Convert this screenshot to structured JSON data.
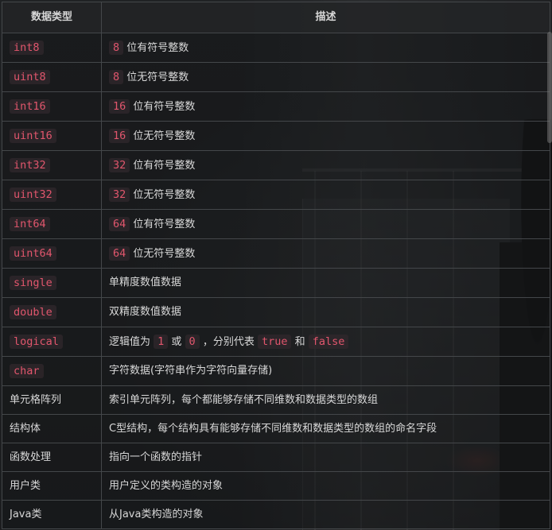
{
  "table": {
    "headers": [
      "数据类型",
      "描述"
    ],
    "rows": [
      {
        "type": "int8",
        "type_code": true,
        "desc": [
          {
            "code": "8"
          },
          {
            "text": " 位有符号整数"
          }
        ]
      },
      {
        "type": "uint8",
        "type_code": true,
        "desc": [
          {
            "code": "8"
          },
          {
            "text": " 位无符号整数"
          }
        ]
      },
      {
        "type": "int16",
        "type_code": true,
        "desc": [
          {
            "code": "16"
          },
          {
            "text": " 位有符号整数"
          }
        ]
      },
      {
        "type": "uint16",
        "type_code": true,
        "desc": [
          {
            "code": "16"
          },
          {
            "text": " 位无符号整数"
          }
        ]
      },
      {
        "type": "int32",
        "type_code": true,
        "desc": [
          {
            "code": "32"
          },
          {
            "text": " 位有符号整数"
          }
        ]
      },
      {
        "type": "uint32",
        "type_code": true,
        "desc": [
          {
            "code": "32"
          },
          {
            "text": " 位无符号整数"
          }
        ]
      },
      {
        "type": "int64",
        "type_code": true,
        "desc": [
          {
            "code": "64"
          },
          {
            "text": " 位有符号整数"
          }
        ]
      },
      {
        "type": "uint64",
        "type_code": true,
        "desc": [
          {
            "code": "64"
          },
          {
            "text": " 位无符号整数"
          }
        ]
      },
      {
        "type": "single",
        "type_code": true,
        "desc": [
          {
            "text": "单精度数值数据"
          }
        ]
      },
      {
        "type": "double",
        "type_code": true,
        "desc": [
          {
            "text": "双精度数值数据"
          }
        ]
      },
      {
        "type": "logical",
        "type_code": true,
        "desc": [
          {
            "text": "逻辑值为 "
          },
          {
            "code": "1"
          },
          {
            "text": " 或 "
          },
          {
            "code": "0"
          },
          {
            "text": " ，分别代表 "
          },
          {
            "code": "true"
          },
          {
            "text": " 和 "
          },
          {
            "code": "false"
          }
        ]
      },
      {
        "type": "char",
        "type_code": true,
        "desc": [
          {
            "text": "字符数据(字符串作为字符向量存储)"
          }
        ]
      },
      {
        "type": "单元格阵列",
        "type_code": false,
        "desc": [
          {
            "text": "索引单元阵列，每个都能够存储不同维数和数据类型的数组"
          }
        ]
      },
      {
        "type": "结构体",
        "type_code": false,
        "desc": [
          {
            "text": "C型结构，每个结构具有能够存储不同维数和数据类型的数组的命名字段"
          }
        ]
      },
      {
        "type": "函数处理",
        "type_code": false,
        "desc": [
          {
            "text": "指向一个函数的指针"
          }
        ]
      },
      {
        "type": "用户类",
        "type_code": false,
        "desc": [
          {
            "text": "用户定义的类构造的对象"
          }
        ]
      },
      {
        "type": "Java类",
        "type_code": false,
        "desc": [
          {
            "text": "从Java类构造的对象"
          }
        ]
      }
    ]
  },
  "colors": {
    "code_text": "#e2566d",
    "code_bg": "#30282c",
    "border": "#44474a",
    "text": "#d8d8d8"
  }
}
